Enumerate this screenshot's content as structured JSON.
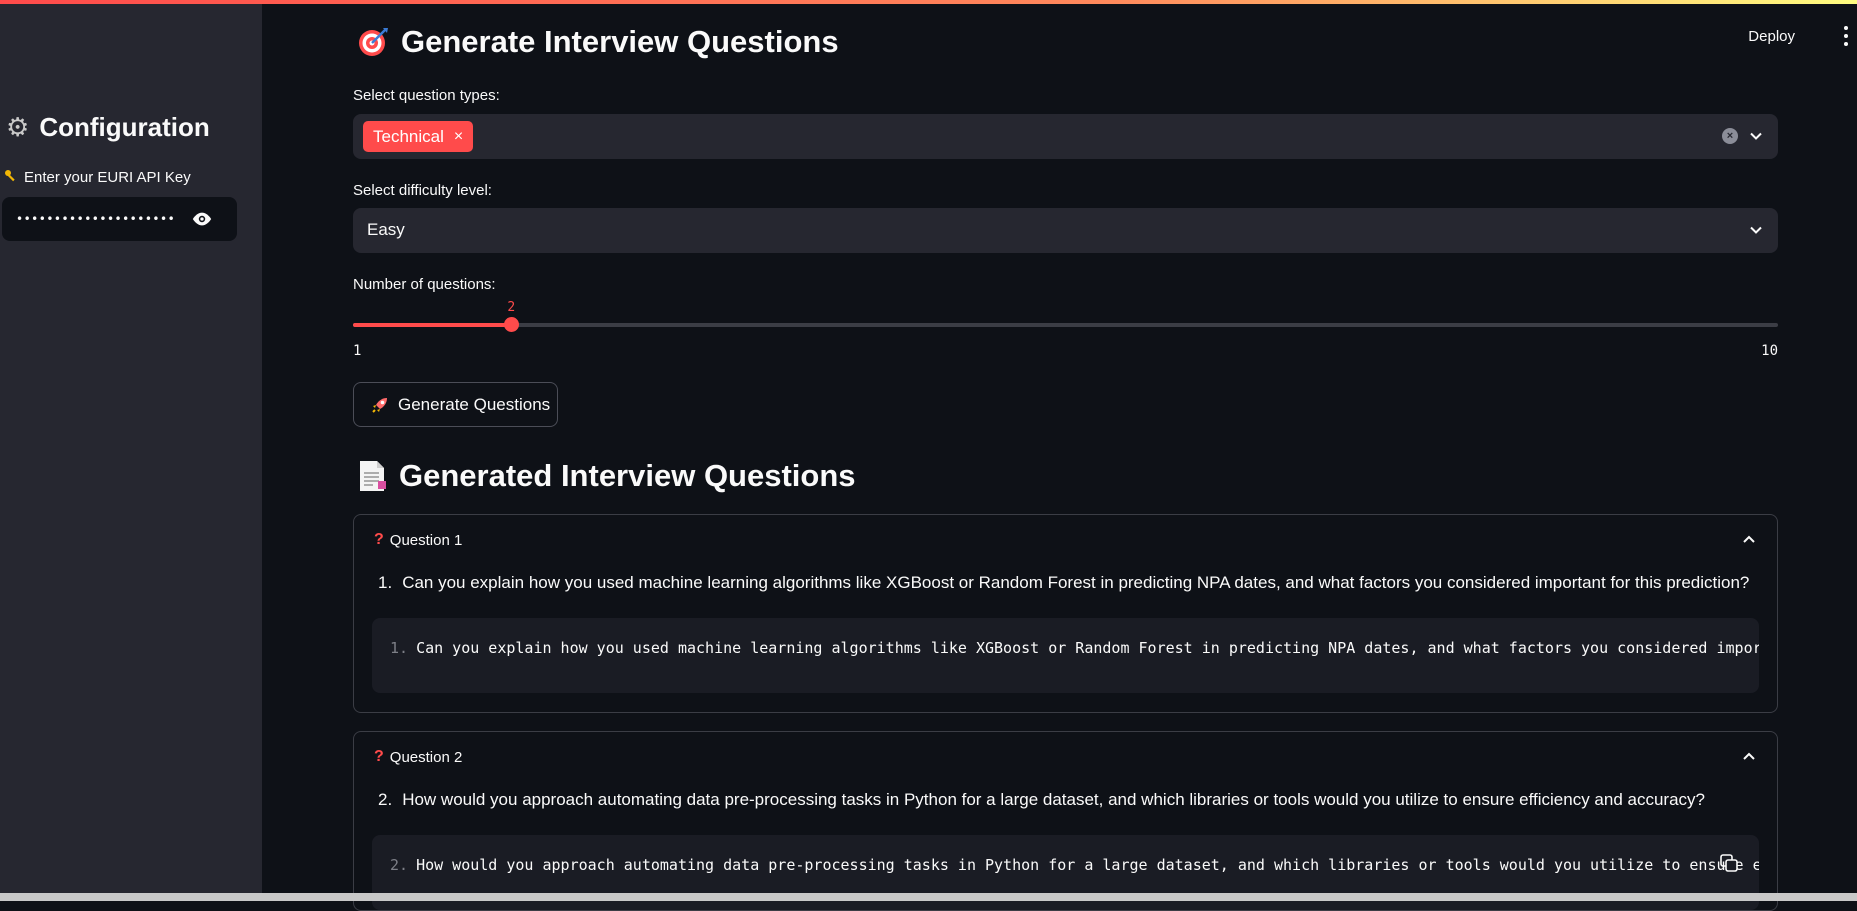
{
  "colors": {
    "accent": "#ff4b4b",
    "background": "#0e1117",
    "sidebar": "#262730"
  },
  "header": {
    "deploy_label": "Deploy"
  },
  "sidebar": {
    "title": "Configuration",
    "title_icon": "gear-icon",
    "api_key_label": "Enter your EURI API Key",
    "api_key_icon": "key-icon",
    "api_key_value": "••••••••••••••••••••••••••••••••••••"
  },
  "main": {
    "title": "Generate Interview Questions",
    "title_icon": "target-icon",
    "question_types": {
      "label": "Select question types:",
      "selected": [
        "Technical"
      ]
    },
    "difficulty": {
      "label": "Select difficulty level:",
      "value": "Easy"
    },
    "num_questions": {
      "label": "Number of questions:",
      "value": "2",
      "min": "1",
      "max": "10"
    },
    "generate_button": {
      "label": "Generate Questions",
      "icon": "rocket-icon"
    },
    "results": {
      "title": "Generated Interview Questions",
      "title_icon": "document-icon",
      "questions": [
        {
          "header": "Question 1",
          "number": "1.",
          "text": "Can you explain how you used machine learning algorithms like XGBoost or Random Forest in predicting NPA dates, and what factors you considered important for this prediction?",
          "code_line_no": "1.",
          "code_text": "Can you explain how you used machine learning algorithms like XGBoost or Random Forest in predicting NPA dates, and what factors you considered important for this prediction?"
        },
        {
          "header": "Question 2",
          "number": "2.",
          "text": "How would you approach automating data pre-processing tasks in Python for a large dataset, and which libraries or tools would you utilize to ensure efficiency and accuracy?",
          "code_line_no": "2.",
          "code_text": "How would you approach automating data pre-processing tasks in Python for a large dataset, and which libraries or tools would you utilize to ensure efficiency and accuracy?"
        }
      ]
    }
  }
}
